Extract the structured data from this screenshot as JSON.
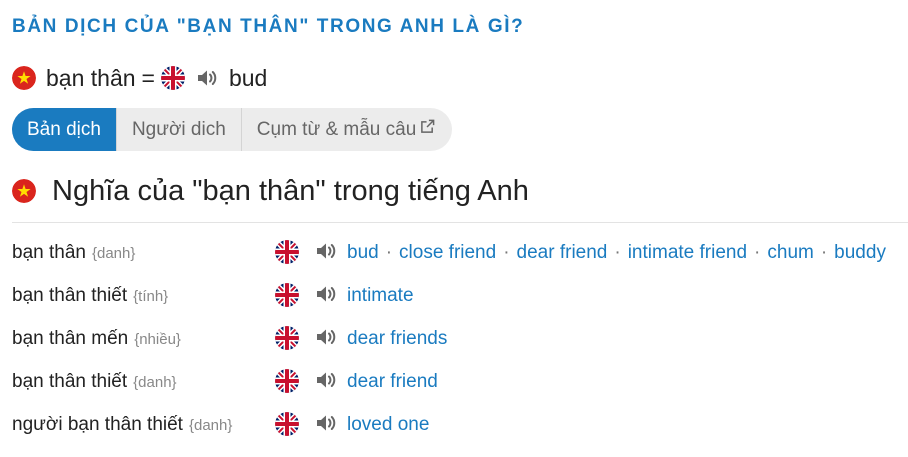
{
  "heading": "BẢN DỊCH CỦA \"BẠN THÂN\" TRONG ANH LÀ GÌ?",
  "main": {
    "term": "bạn thân",
    "equals": "=",
    "translation": "bud"
  },
  "tabs": [
    {
      "label": "Bản dịch",
      "active": true
    },
    {
      "label": "Người dich",
      "active": false
    },
    {
      "label": "Cụm từ & mẫu câu",
      "active": false,
      "external": true
    }
  ],
  "section_title": "Nghĩa của \"bạn thân\" trong tiếng Anh",
  "separator": "·",
  "rows": [
    {
      "term": "bạn thân",
      "pos": "{danh}",
      "translations": [
        "bud",
        "close friend",
        "dear friend",
        "intimate friend",
        "chum",
        "buddy"
      ]
    },
    {
      "term": "bạn thân thiết",
      "pos": "{tính}",
      "translations": [
        "intimate"
      ]
    },
    {
      "term": "bạn thân mến",
      "pos": "{nhiều}",
      "translations": [
        "dear friends"
      ]
    },
    {
      "term": "bạn thân thiết",
      "pos": "{danh}",
      "translations": [
        "dear friend"
      ]
    },
    {
      "term": "người bạn thân thiết",
      "pos": "{danh}",
      "translations": [
        "loved one"
      ]
    }
  ],
  "icons": {
    "vn_flag": "vietnam-flag-icon",
    "uk_flag": "uk-flag-icon",
    "speaker": "speaker-icon",
    "external": "external-link-icon"
  },
  "colors": {
    "accent": "#1a7bc0",
    "vn_red": "#da251d",
    "vn_star": "#ffde00",
    "uk_blue": "#012169",
    "uk_red": "#c8102e",
    "tab_bg": "#ececec"
  }
}
